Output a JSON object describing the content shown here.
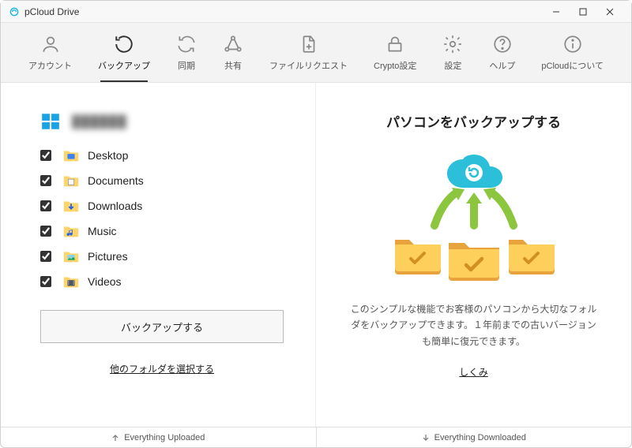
{
  "window": {
    "title": "pCloud Drive"
  },
  "toolbar": {
    "tabs": [
      {
        "label": "アカウント"
      },
      {
        "label": "バックアップ"
      },
      {
        "label": "同期"
      },
      {
        "label": "共有"
      },
      {
        "label": "ファイルリクエスト"
      },
      {
        "label": "Crypto設定"
      },
      {
        "label": "設定"
      },
      {
        "label": "ヘルプ"
      },
      {
        "label": "pCloudについて"
      }
    ]
  },
  "left": {
    "computer_name": "██████",
    "folders": [
      {
        "name": "Desktop"
      },
      {
        "name": "Documents"
      },
      {
        "name": "Downloads"
      },
      {
        "name": "Music"
      },
      {
        "name": "Pictures"
      },
      {
        "name": "Videos"
      }
    ],
    "backup_button": "バックアップする",
    "other_folders": "他のフォルダを選択する"
  },
  "right": {
    "heading": "パソコンをバックアップする",
    "description": "このシンプルな機能でお客様のパソコンから大切なフォルダをバックアップできます。１年前までの古いバージョンも簡単に復元できます。",
    "link": "しくみ"
  },
  "status": {
    "uploaded": "Everything Uploaded",
    "downloaded": "Everything Downloaded"
  }
}
